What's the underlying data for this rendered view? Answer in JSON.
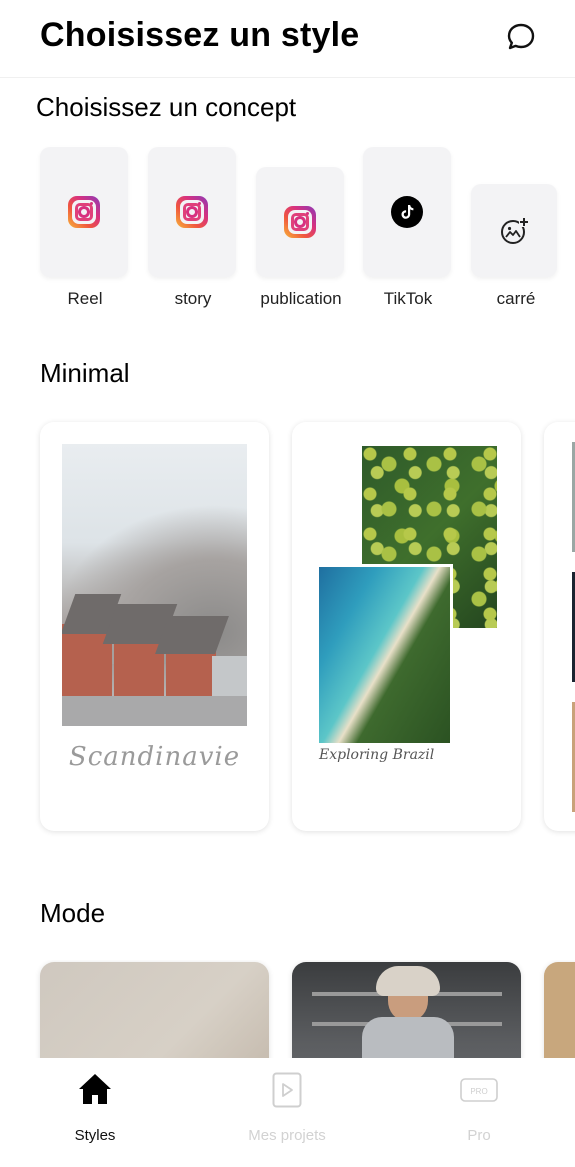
{
  "header": {
    "title": "Choisissez un style",
    "chat_icon": "chat-bubble-icon"
  },
  "concepts": {
    "title": "Choisissez un concept",
    "items": [
      {
        "label": "Reel",
        "icon": "instagram-icon"
      },
      {
        "label": "story",
        "icon": "instagram-icon"
      },
      {
        "label": "publication",
        "icon": "instagram-icon"
      },
      {
        "label": "TikTok",
        "icon": "tiktok-icon"
      },
      {
        "label": "carré",
        "icon": "add-image-icon"
      }
    ]
  },
  "minimal": {
    "title": "Minimal",
    "cards": [
      {
        "caption": "Scandinavie"
      },
      {
        "caption": "Exploring Brazil"
      }
    ]
  },
  "mode": {
    "title": "Mode"
  },
  "bottom_nav": {
    "items": [
      {
        "label": "Styles",
        "icon": "home-icon",
        "active": true
      },
      {
        "label": "Mes projets",
        "icon": "play-square-icon",
        "active": false
      },
      {
        "label": "Pro",
        "icon": "pro-badge-icon",
        "active": false
      }
    ]
  }
}
